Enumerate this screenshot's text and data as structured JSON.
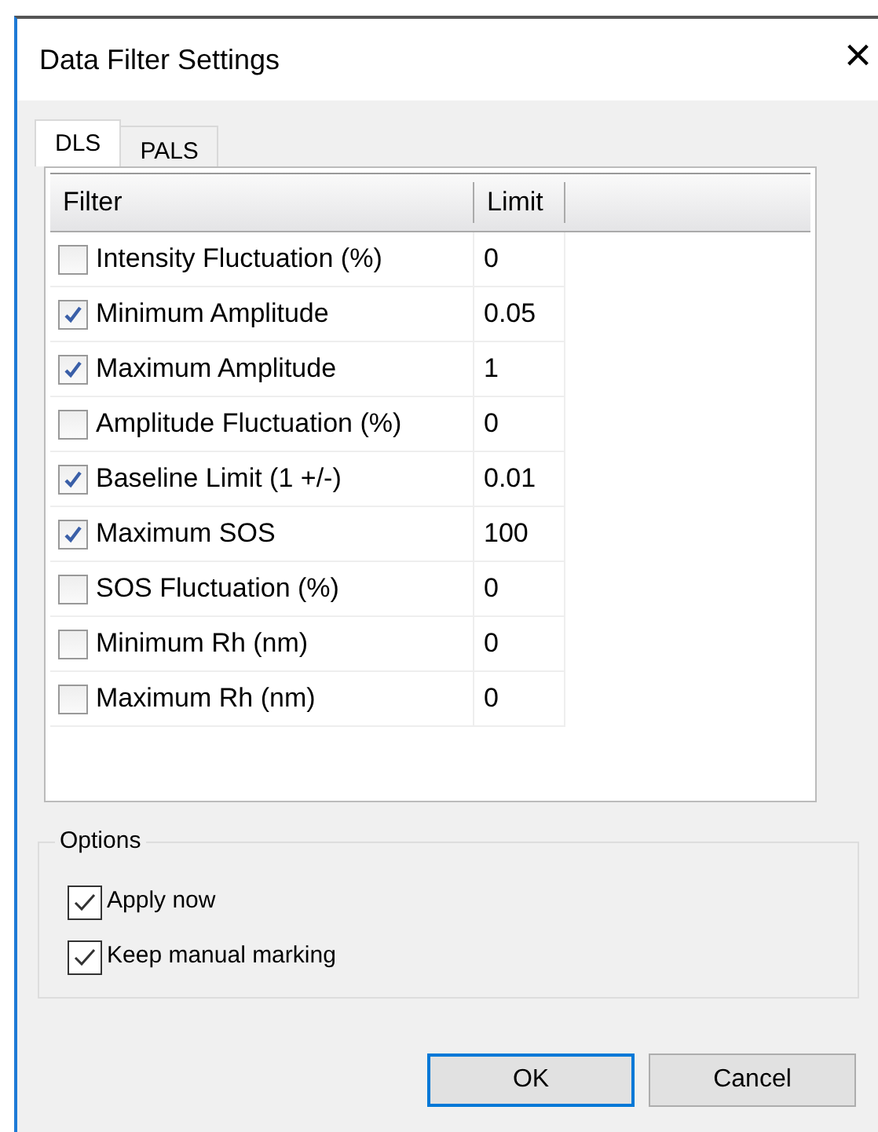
{
  "window": {
    "title": "Data Filter Settings",
    "close": "×"
  },
  "tabs": [
    {
      "label": "DLS",
      "selected": true
    },
    {
      "label": "PALS",
      "selected": false
    }
  ],
  "table": {
    "columns": [
      "Filter",
      "Limit"
    ],
    "rows": [
      {
        "filter": "Intensity Fluctuation (%)",
        "checked": false,
        "limit": "0"
      },
      {
        "filter": "Minimum Amplitude",
        "checked": true,
        "limit": "0.05"
      },
      {
        "filter": "Maximum Amplitude",
        "checked": true,
        "limit": "1"
      },
      {
        "filter": "Amplitude Fluctuation (%)",
        "checked": false,
        "limit": "0"
      },
      {
        "filter": "Baseline Limit (1 +/-)",
        "checked": true,
        "limit": "0.01"
      },
      {
        "filter": "Maximum SOS",
        "checked": true,
        "limit": "100"
      },
      {
        "filter": "SOS Fluctuation (%)",
        "checked": false,
        "limit": "0"
      },
      {
        "filter": "Minimum Rh (nm)",
        "checked": false,
        "limit": "0"
      },
      {
        "filter": "Maximum Rh (nm)",
        "checked": false,
        "limit": "0"
      }
    ]
  },
  "options": {
    "title": "Options",
    "items": [
      {
        "label": "Apply now",
        "checked": true
      },
      {
        "label": "Keep manual marking",
        "checked": true
      }
    ]
  },
  "buttons": [
    {
      "label": "OK",
      "default": true
    },
    {
      "label": "Cancel",
      "default": false
    }
  ]
}
